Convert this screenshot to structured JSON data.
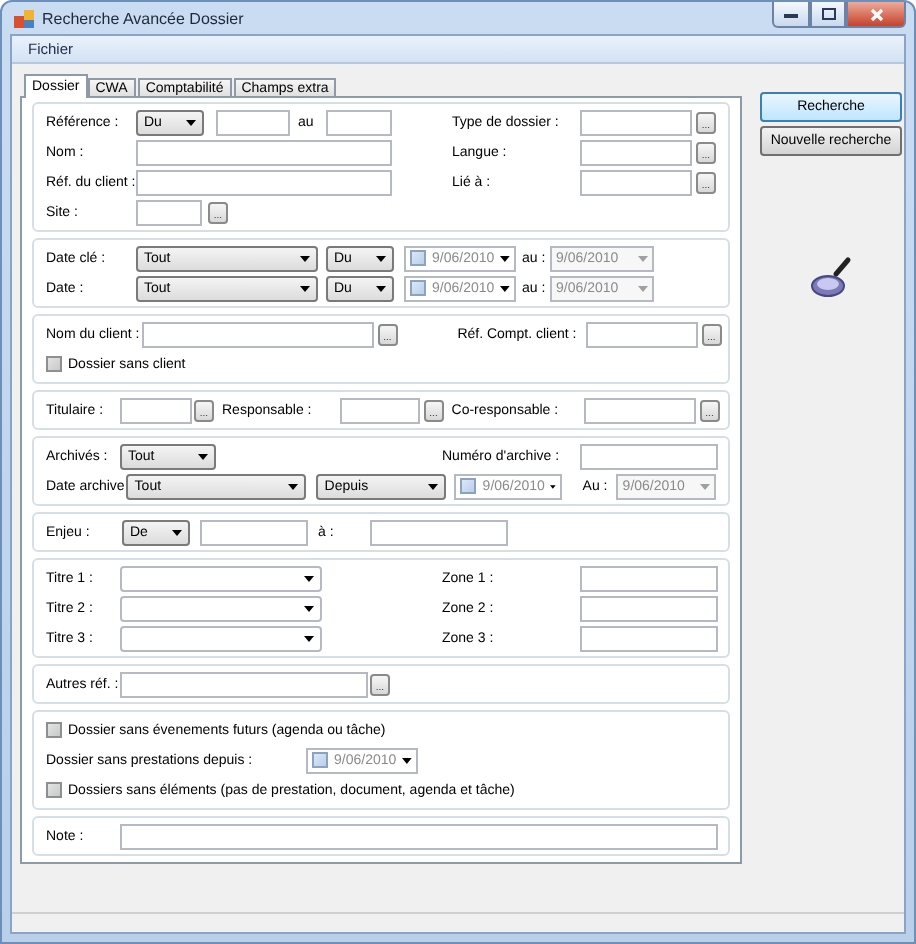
{
  "window": {
    "title": "Recherche Avancée Dossier"
  },
  "menu": [
    {
      "label": "Fichier"
    }
  ],
  "tabs": [
    {
      "label": "Dossier",
      "selected": true
    },
    {
      "label": "CWA",
      "selected": false
    },
    {
      "label": "Comptabilité",
      "selected": false
    },
    {
      "label": "Champs extra",
      "selected": false
    }
  ],
  "general": {
    "reference": {
      "label": "Référence :",
      "from": "Du",
      "to_label": "au"
    },
    "nom": {
      "label": "Nom :"
    },
    "ref_client": {
      "label": "Réf. du client :"
    },
    "site": {
      "label": "Site :",
      "button": "..."
    },
    "right_fields": [
      {
        "label": "Type de dossier :",
        "button": "..."
      },
      {
        "label": "Langue :",
        "button": "..."
      },
      {
        "label": "Lié à :",
        "button": "..."
      }
    ]
  },
  "dates": [
    {
      "label": "Date clé :",
      "period": "Tout",
      "from": "Du",
      "date": {
        "value": "9/06/2010",
        "checked": false
      },
      "to_label": "au :",
      "to_date": {
        "value": "9/06/2010",
        "disabled": true
      }
    },
    {
      "label": "Date :",
      "period": "Tout",
      "from": "Du",
      "date": {
        "value": "9/06/2010",
        "checked": false
      },
      "to_label": "au :",
      "to_date": {
        "value": "9/06/2010",
        "disabled": true
      }
    }
  ],
  "client": {
    "name": {
      "label": "Nom du client :",
      "button": "..."
    },
    "account": {
      "label": "Réf. Compt. client :",
      "button": "..."
    },
    "no_client": {
      "label": "Dossier sans client",
      "checked": false
    }
  },
  "people": [
    {
      "label": "Titulaire :",
      "button": "..."
    },
    {
      "label": "Responsable :",
      "button": "..."
    },
    {
      "label": "Co-responsable :",
      "button": "..."
    }
  ],
  "archive": {
    "archived": {
      "label": "Archivés :",
      "value": "Tout"
    },
    "number": {
      "label": "Numéro d'archive :"
    },
    "date": {
      "label": "Date archive",
      "period": "Tout",
      "mode": "Depuis",
      "date": {
        "value": "9/06/2010",
        "checked": false
      },
      "to_label": "Au :",
      "to_date": {
        "value": "9/06/2010",
        "disabled": true
      }
    }
  },
  "stake": {
    "label": "Enjeu :",
    "from": "De",
    "to_label": "à :"
  },
  "titles": [
    {
      "label": "Titre 1 :"
    },
    {
      "label": "Titre 2 :"
    },
    {
      "label": "Titre 3 :"
    }
  ],
  "zones": [
    {
      "label": "Zone 1 :"
    },
    {
      "label": "Zone 2 :"
    },
    {
      "label": "Zone 3 :"
    }
  ],
  "other_refs": {
    "label": "Autres réf. :",
    "button": "..."
  },
  "without": {
    "future": {
      "label": "Dossier sans évenements futurs (agenda ou tâche)",
      "checked": false
    },
    "services": {
      "label": "Dossier sans prestations depuis :",
      "date": {
        "value": "9/06/2010",
        "checked": false
      }
    },
    "elements": {
      "label": "Dossiers sans éléments (pas de prestation, document, agenda et tâche)",
      "checked": false
    }
  },
  "note": {
    "label": "Note :"
  },
  "actions": [
    {
      "label": "Recherche",
      "default": true
    },
    {
      "label": "Nouvelle recherche",
      "default": false
    }
  ]
}
